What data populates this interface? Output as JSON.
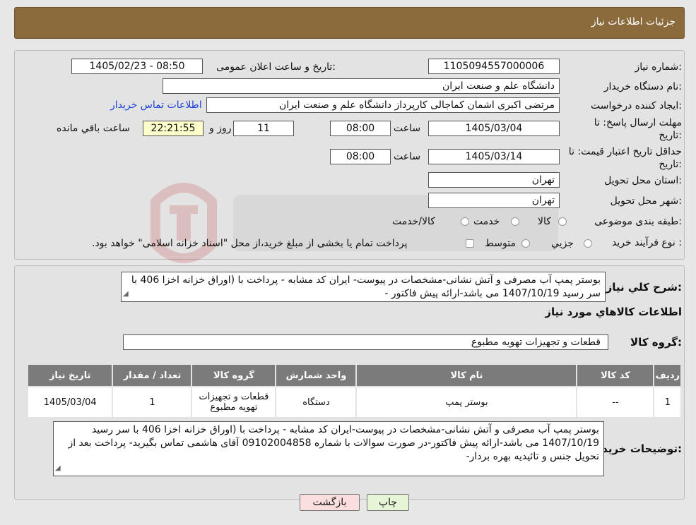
{
  "header": {
    "title": "جزئیات اطلاعات نیاز"
  },
  "form": {
    "need_number_label": "شماره نیاز:",
    "need_number": "1105094557000006",
    "announce_label": "تاریخ و ساعت اعلان عمومی:",
    "announce_value": "1405/02/23 - 08:50",
    "buyer_org_label": "نام دستگاه خریدار:",
    "buyer_org": "دانشگاه علم و صنعت ایران",
    "creator_label": "ایجاد کننده درخواست:",
    "creator": "مرتضی اکبری اشمان کماجالی کارپرداز دانشگاه علم و صنعت ایران",
    "contact_link": "اطلاعات تماس خریدار",
    "deadline_label_1": "مهلت ارسال پاسخ: تا",
    "deadline_label_2": "تاریخ:",
    "deadline_date": "1405/03/04",
    "time_label": "ساعت",
    "deadline_time": "08:00",
    "days_value": "11",
    "days_label": "روز و",
    "remaining_time": "22:21:55",
    "remaining_label": "ساعت باقي مانده",
    "validity_label_1": "حداقل تاریخ اعتبار قیمت: تا",
    "validity_label_2": "تاریخ:",
    "validity_date": "1405/03/14",
    "validity_time": "08:00",
    "province_label": "استان محل تحویل:",
    "province": "تهران",
    "city_label": "شهر محل تحویل:",
    "city": "تهران",
    "category_label": "طبقه بندی موضوعی:",
    "category_options": [
      "کالا",
      "خدمت",
      "کالا/خدمت"
    ],
    "process_label": "نوع فرآیند خرید :",
    "process_options": [
      "جزیي",
      "متوسط"
    ],
    "process_note": "پرداخت تمام یا بخشی از مبلغ خرید،از محل \"اسناد خزانه اسلامی\" خواهد بود."
  },
  "summary": {
    "label": "شرح کلي نياز:",
    "text": "بوستر پمپ آب مصرفی و آتش نشانی-مشخصات در پیوست- ایران کد مشابه - پرداخت با (اوراق خزانه  اخزا 406 با سر رسید 1407/10/19 می باشد-ارائه پیش فاکتور -",
    "goods_info_title": "اطلاعات کالاهاي مورد نياز",
    "group_label": "گروه کالا:",
    "group_value": "قطعات و تجهیزات تهویه مطبوع"
  },
  "table": {
    "headers": [
      "رديف",
      "کد کالا",
      "نام کالا",
      "واحد شمارش",
      "گروه کالا",
      "تعداد / مقدار",
      "تاريخ نياز"
    ],
    "rows": [
      [
        "1",
        "--",
        "بوستر پمپ",
        "دستگاه",
        "قطعات و تجهیزات تهویه مطبوع",
        "1",
        "1405/03/04"
      ]
    ]
  },
  "notes": {
    "label": "توضیحات خریدار:",
    "text": "بوستر پمپ آب مصرفی و آتش نشانی-مشخصات در پیوست-ایران کد مشابه - پرداخت با (اوراق خزانه اخزا 406 با سر رسید 1407/10/19 می باشد-ارائه پیش فاکتور-در صورت سوالات با شماره 09102004858 آقای هاشمی تماس بگیرید- پرداخت بعد از تحویل جنس و تائیدیه بهره بردار-"
  },
  "buttons": {
    "print": "چاپ",
    "back": "بازگشت"
  },
  "colors": {
    "header": "#8b6a3c",
    "print_btn": "#e6f5d6",
    "back_btn": "#fbdede",
    "link": "#1a3fd6"
  }
}
